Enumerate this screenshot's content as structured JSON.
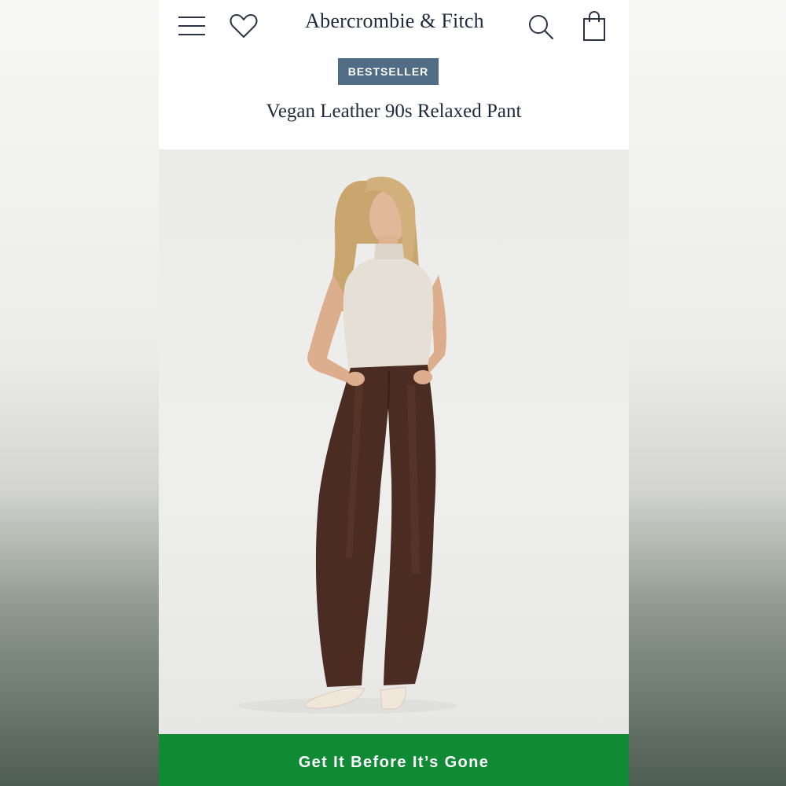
{
  "header": {
    "logo_text": "Abercrombie & Fitch",
    "icons": [
      "menu-icon",
      "heart-icon",
      "search-icon",
      "shopping-bag-icon"
    ]
  },
  "product": {
    "badge": "BESTSELLER",
    "title": "Vegan Leather 90s Relaxed Pant"
  },
  "cta": {
    "label": "Get It Before It’s Gone"
  },
  "colors": {
    "badge_bg": "#516d86",
    "brand_text": "#1e2b3f",
    "cta_bg": "#118a36",
    "pants": "#4a2c22",
    "top": "#e6dfd6"
  }
}
